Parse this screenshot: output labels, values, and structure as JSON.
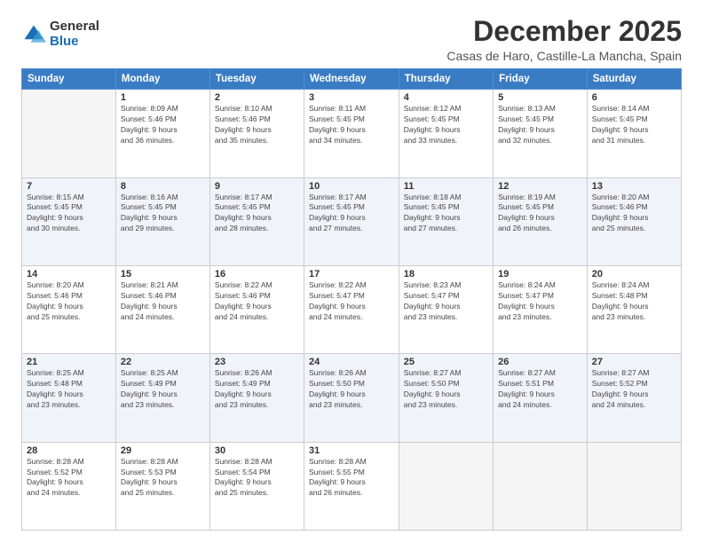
{
  "header": {
    "logo_general": "General",
    "logo_blue": "Blue",
    "month_title": "December 2025",
    "location": "Casas de Haro, Castille-La Mancha, Spain"
  },
  "days_of_week": [
    "Sunday",
    "Monday",
    "Tuesday",
    "Wednesday",
    "Thursday",
    "Friday",
    "Saturday"
  ],
  "weeks": [
    {
      "shaded": false,
      "days": [
        {
          "num": "",
          "detail": ""
        },
        {
          "num": "1",
          "detail": "Sunrise: 8:09 AM\nSunset: 5:46 PM\nDaylight: 9 hours\nand 36 minutes."
        },
        {
          "num": "2",
          "detail": "Sunrise: 8:10 AM\nSunset: 5:46 PM\nDaylight: 9 hours\nand 35 minutes."
        },
        {
          "num": "3",
          "detail": "Sunrise: 8:11 AM\nSunset: 5:45 PM\nDaylight: 9 hours\nand 34 minutes."
        },
        {
          "num": "4",
          "detail": "Sunrise: 8:12 AM\nSunset: 5:45 PM\nDaylight: 9 hours\nand 33 minutes."
        },
        {
          "num": "5",
          "detail": "Sunrise: 8:13 AM\nSunset: 5:45 PM\nDaylight: 9 hours\nand 32 minutes."
        },
        {
          "num": "6",
          "detail": "Sunrise: 8:14 AM\nSunset: 5:45 PM\nDaylight: 9 hours\nand 31 minutes."
        }
      ]
    },
    {
      "shaded": true,
      "days": [
        {
          "num": "7",
          "detail": "Sunrise: 8:15 AM\nSunset: 5:45 PM\nDaylight: 9 hours\nand 30 minutes."
        },
        {
          "num": "8",
          "detail": "Sunrise: 8:16 AM\nSunset: 5:45 PM\nDaylight: 9 hours\nand 29 minutes."
        },
        {
          "num": "9",
          "detail": "Sunrise: 8:17 AM\nSunset: 5:45 PM\nDaylight: 9 hours\nand 28 minutes."
        },
        {
          "num": "10",
          "detail": "Sunrise: 8:17 AM\nSunset: 5:45 PM\nDaylight: 9 hours\nand 27 minutes."
        },
        {
          "num": "11",
          "detail": "Sunrise: 8:18 AM\nSunset: 5:45 PM\nDaylight: 9 hours\nand 27 minutes."
        },
        {
          "num": "12",
          "detail": "Sunrise: 8:19 AM\nSunset: 5:45 PM\nDaylight: 9 hours\nand 26 minutes."
        },
        {
          "num": "13",
          "detail": "Sunrise: 8:20 AM\nSunset: 5:46 PM\nDaylight: 9 hours\nand 25 minutes."
        }
      ]
    },
    {
      "shaded": false,
      "days": [
        {
          "num": "14",
          "detail": "Sunrise: 8:20 AM\nSunset: 5:46 PM\nDaylight: 9 hours\nand 25 minutes."
        },
        {
          "num": "15",
          "detail": "Sunrise: 8:21 AM\nSunset: 5:46 PM\nDaylight: 9 hours\nand 24 minutes."
        },
        {
          "num": "16",
          "detail": "Sunrise: 8:22 AM\nSunset: 5:46 PM\nDaylight: 9 hours\nand 24 minutes."
        },
        {
          "num": "17",
          "detail": "Sunrise: 8:22 AM\nSunset: 5:47 PM\nDaylight: 9 hours\nand 24 minutes."
        },
        {
          "num": "18",
          "detail": "Sunrise: 8:23 AM\nSunset: 5:47 PM\nDaylight: 9 hours\nand 23 minutes."
        },
        {
          "num": "19",
          "detail": "Sunrise: 8:24 AM\nSunset: 5:47 PM\nDaylight: 9 hours\nand 23 minutes."
        },
        {
          "num": "20",
          "detail": "Sunrise: 8:24 AM\nSunset: 5:48 PM\nDaylight: 9 hours\nand 23 minutes."
        }
      ]
    },
    {
      "shaded": true,
      "days": [
        {
          "num": "21",
          "detail": "Sunrise: 8:25 AM\nSunset: 5:48 PM\nDaylight: 9 hours\nand 23 minutes."
        },
        {
          "num": "22",
          "detail": "Sunrise: 8:25 AM\nSunset: 5:49 PM\nDaylight: 9 hours\nand 23 minutes."
        },
        {
          "num": "23",
          "detail": "Sunrise: 8:26 AM\nSunset: 5:49 PM\nDaylight: 9 hours\nand 23 minutes."
        },
        {
          "num": "24",
          "detail": "Sunrise: 8:26 AM\nSunset: 5:50 PM\nDaylight: 9 hours\nand 23 minutes."
        },
        {
          "num": "25",
          "detail": "Sunrise: 8:27 AM\nSunset: 5:50 PM\nDaylight: 9 hours\nand 23 minutes."
        },
        {
          "num": "26",
          "detail": "Sunrise: 8:27 AM\nSunset: 5:51 PM\nDaylight: 9 hours\nand 24 minutes."
        },
        {
          "num": "27",
          "detail": "Sunrise: 8:27 AM\nSunset: 5:52 PM\nDaylight: 9 hours\nand 24 minutes."
        }
      ]
    },
    {
      "shaded": false,
      "days": [
        {
          "num": "28",
          "detail": "Sunrise: 8:28 AM\nSunset: 5:52 PM\nDaylight: 9 hours\nand 24 minutes."
        },
        {
          "num": "29",
          "detail": "Sunrise: 8:28 AM\nSunset: 5:53 PM\nDaylight: 9 hours\nand 25 minutes."
        },
        {
          "num": "30",
          "detail": "Sunrise: 8:28 AM\nSunset: 5:54 PM\nDaylight: 9 hours\nand 25 minutes."
        },
        {
          "num": "31",
          "detail": "Sunrise: 8:28 AM\nSunset: 5:55 PM\nDaylight: 9 hours\nand 26 minutes."
        },
        {
          "num": "",
          "detail": ""
        },
        {
          "num": "",
          "detail": ""
        },
        {
          "num": "",
          "detail": ""
        }
      ]
    }
  ]
}
